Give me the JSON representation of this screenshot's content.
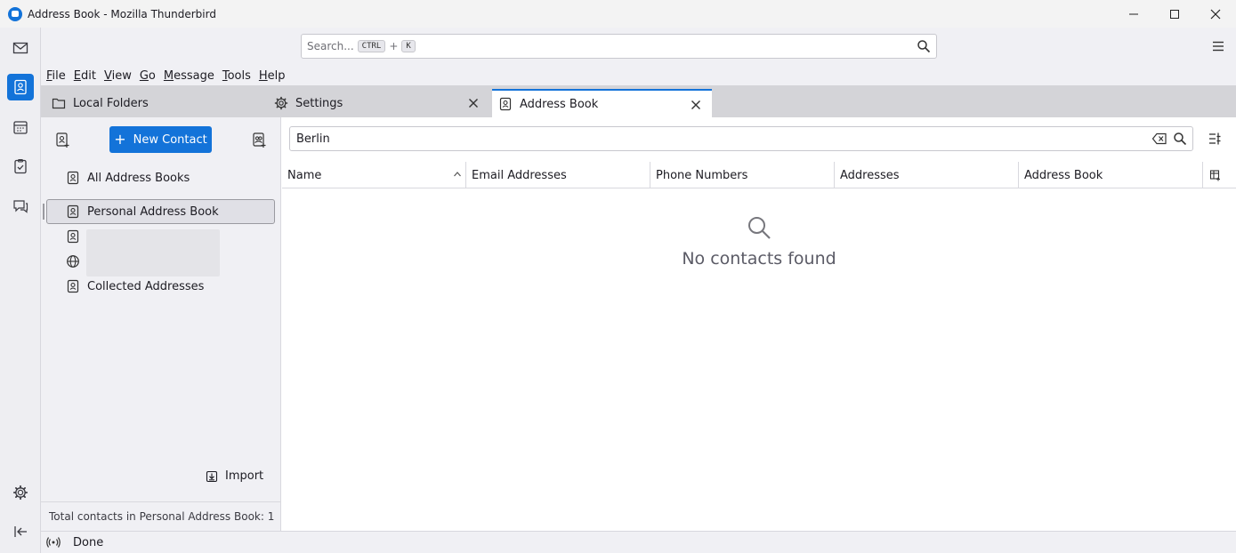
{
  "window": {
    "title": "Address Book - Mozilla Thunderbird"
  },
  "toolbar": {
    "search_placeholder": "Search...",
    "kbd_ctrl": "CTRL",
    "kbd_plus": "+",
    "kbd_k": "K"
  },
  "menu": [
    {
      "label": "File",
      "accel": "F",
      "rest": "ile"
    },
    {
      "label": "Edit",
      "accel": "E",
      "rest": "dit"
    },
    {
      "label": "View",
      "accel": "V",
      "rest": "iew"
    },
    {
      "label": "Go",
      "accel": "G",
      "rest": "o"
    },
    {
      "label": "Message",
      "accel": "M",
      "rest": "essage"
    },
    {
      "label": "Tools",
      "accel": "T",
      "rest": "ools"
    },
    {
      "label": "Help",
      "accel": "H",
      "rest": "elp"
    }
  ],
  "tabs": [
    {
      "label": "Local Folders"
    },
    {
      "label": "Settings"
    },
    {
      "label": "Address Book"
    }
  ],
  "sidebar": {
    "new_contact_label": "New Contact",
    "books": [
      {
        "label": "All Address Books"
      },
      {
        "label": "Personal Address Book"
      },
      {
        "label": ""
      },
      {
        "label": ""
      },
      {
        "label": "Collected Addresses"
      }
    ],
    "import_label": "Import",
    "footer_text": "Total contacts in Personal Address Book: 1"
  },
  "contacts": {
    "search_value": "Berlin",
    "columns": [
      "Name",
      "Email Addresses",
      "Phone Numbers",
      "Addresses",
      "Address Book"
    ],
    "empty_message": "No contacts found"
  },
  "statusbar": {
    "text": "Done"
  }
}
